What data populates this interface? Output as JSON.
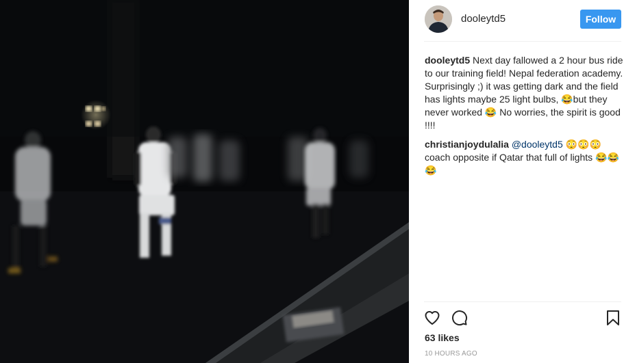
{
  "header": {
    "username": "dooleytd5",
    "follow_label": "Follow"
  },
  "caption": {
    "user": "dooleytd5",
    "text": "Next day fallowed a 2 hour bus ride to our training field! Nepal federation academy. Surprisingly ;) it was getting dark and the field has lights maybe 25 light bulbs, 😂but they never worked 😂 No worries, the spirit is good !!!!"
  },
  "comment": {
    "user": "christianjoydulalia",
    "mention": "@dooleytd5",
    "text": "😳😳😳 coach opposite if Qatar that full of lights 😂😂😂"
  },
  "actions": {
    "like_icon": "heart-icon",
    "comment_icon": "comment-icon",
    "save_icon": "bookmark-icon"
  },
  "likes": "63 likes",
  "timestamp": "10 HOURS AGO",
  "colors": {
    "follow_button": "#3897f0",
    "mention": "#003569",
    "photo_background": "#07080a"
  }
}
